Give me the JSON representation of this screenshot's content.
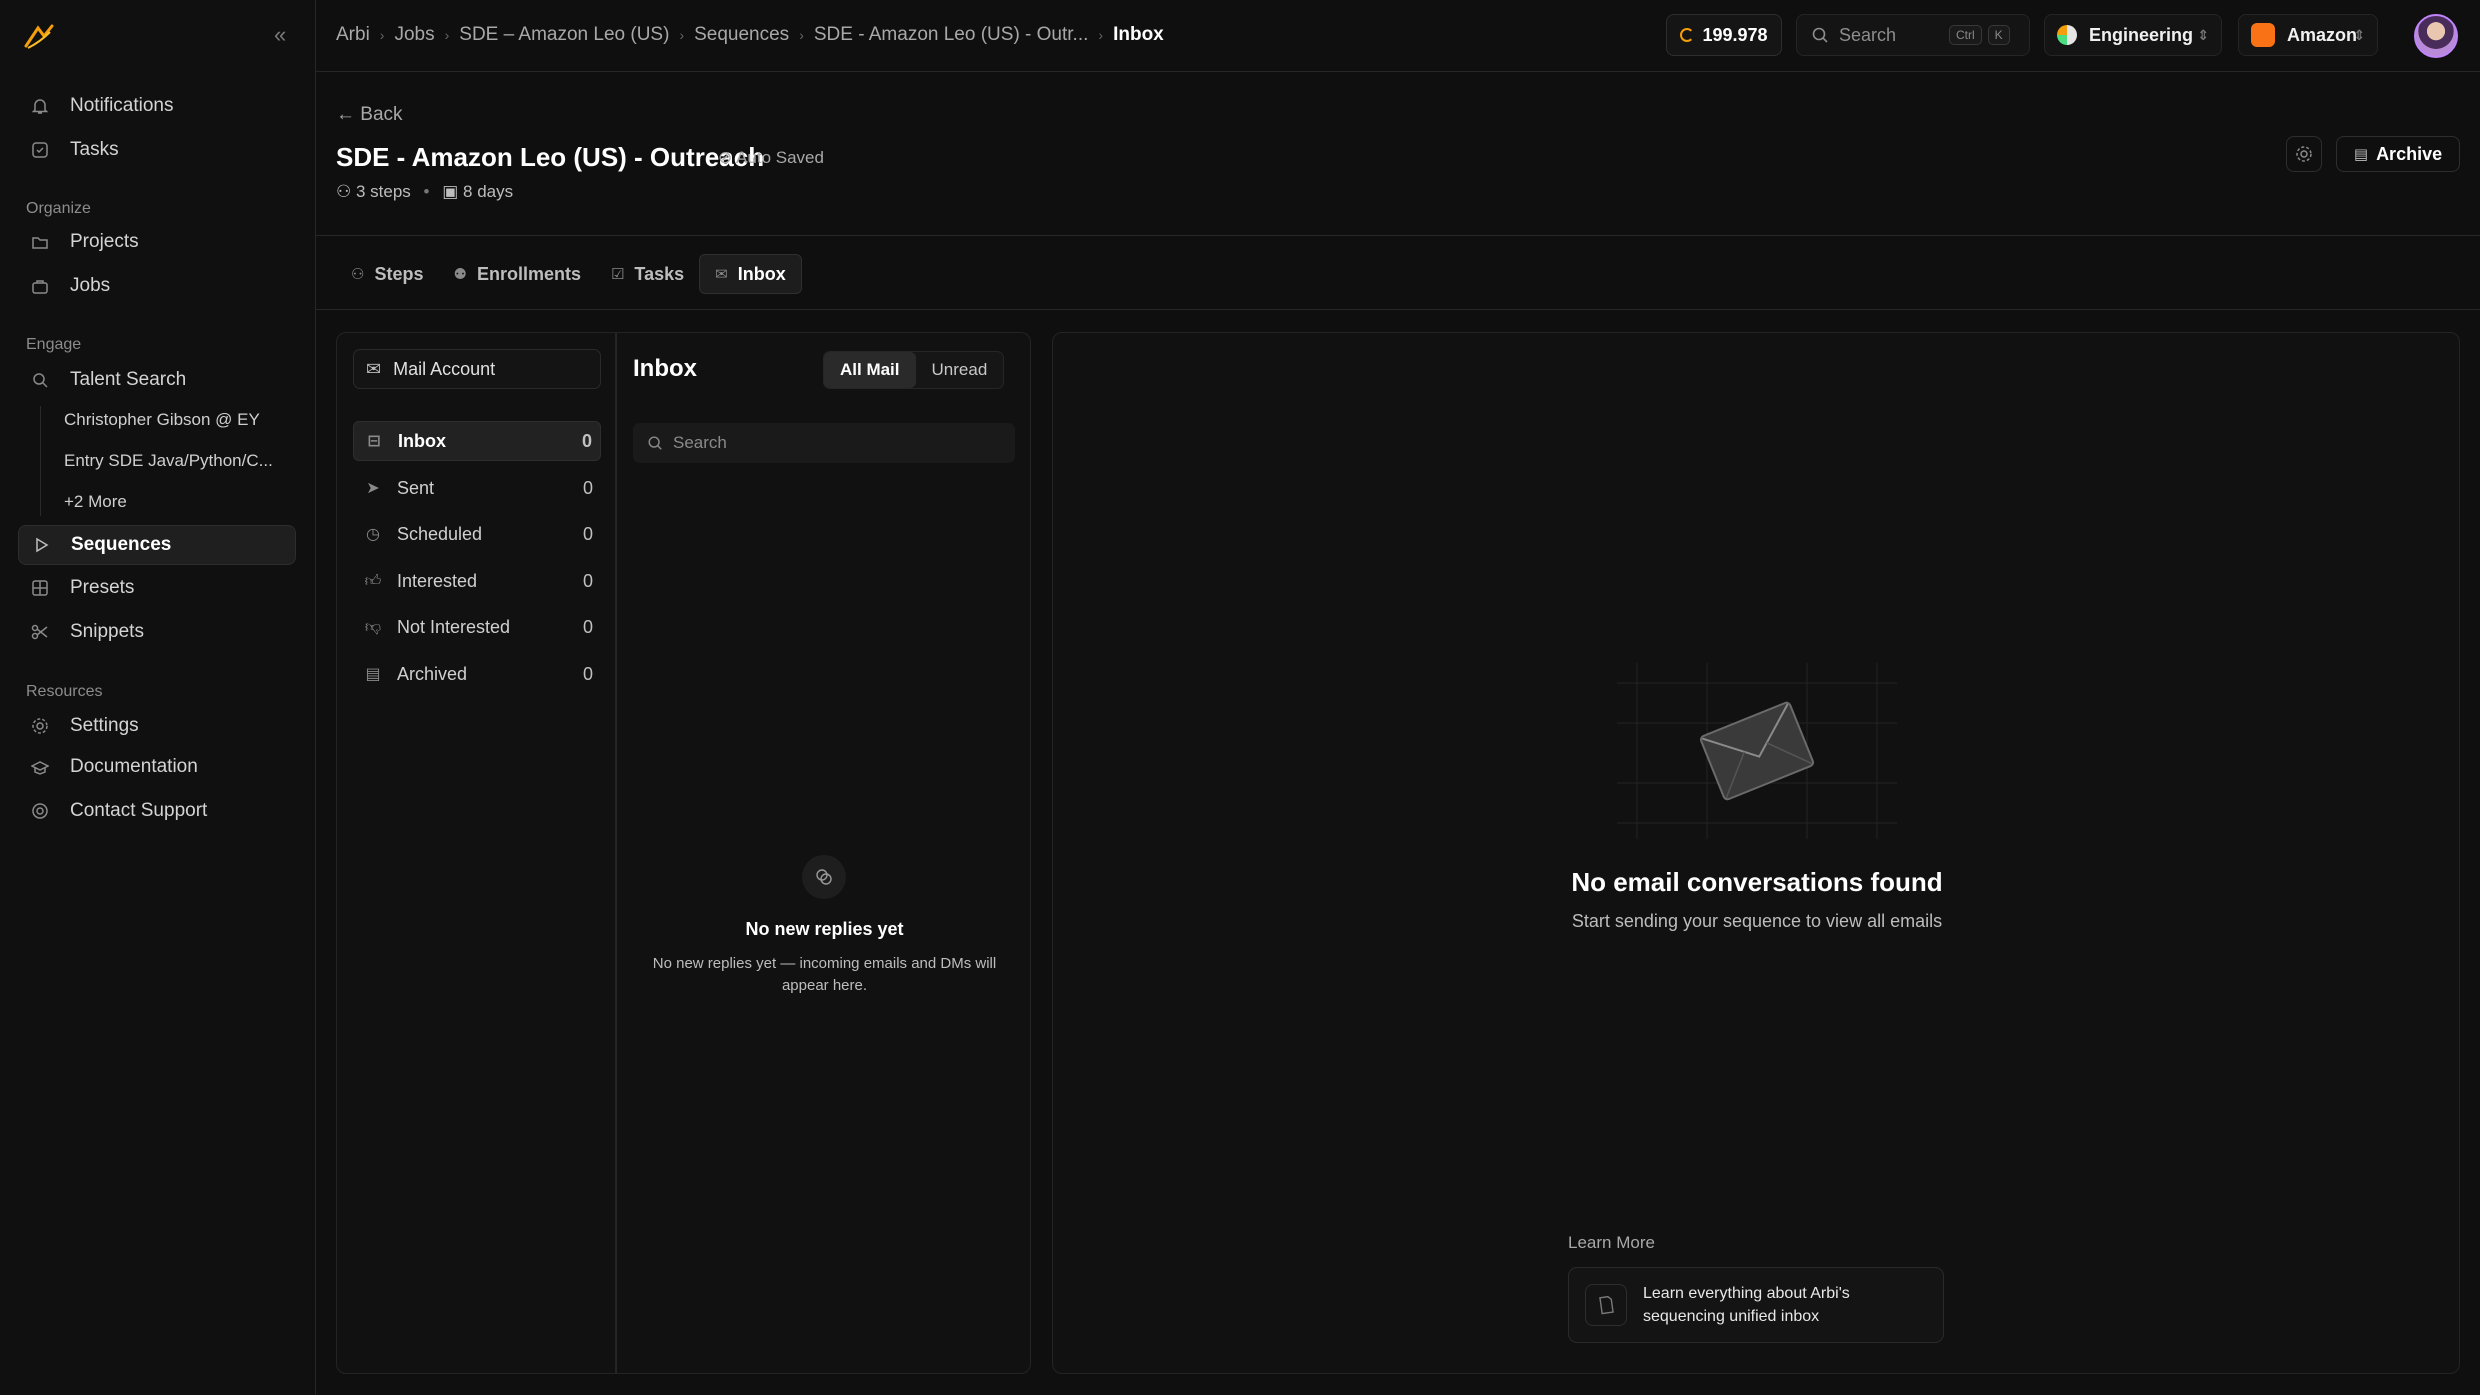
{
  "sidebar": {
    "top": [
      {
        "label": "Notifications",
        "icon": "bell-icon"
      },
      {
        "label": "Tasks",
        "icon": "tasks-icon"
      }
    ],
    "organize_label": "Organize",
    "organize": [
      {
        "label": "Projects",
        "icon": "folder-icon"
      },
      {
        "label": "Jobs",
        "icon": "briefcase-icon"
      }
    ],
    "engage_label": "Engage",
    "talent_search": "Talent Search",
    "saved_searches": [
      "Christopher Gibson @ EY",
      "Entry SDE Java/Python/C...",
      "+2 More"
    ],
    "engage": [
      {
        "label": "Sequences",
        "icon": "play-icon",
        "active": true
      },
      {
        "label": "Presets",
        "icon": "grid-icon"
      },
      {
        "label": "Snippets",
        "icon": "scissors-icon"
      }
    ],
    "resources_label": "Resources",
    "resources": [
      {
        "label": "Settings",
        "icon": "gear-icon"
      },
      {
        "label": "Documentation",
        "icon": "book-icon"
      },
      {
        "label": "Contact Support",
        "icon": "support-icon"
      }
    ]
  },
  "breadcrumbs": [
    "Arbi",
    "Jobs",
    "SDE – Amazon Leo (US)",
    "Sequences",
    "SDE - Amazon Leo (US) - Outr...",
    "Inbox"
  ],
  "topbar": {
    "credits": "199.978",
    "search_label": "Search",
    "kbd_ctrl": "Ctrl",
    "kbd_k": "K",
    "team": "Engineering",
    "company": "Amazon"
  },
  "header": {
    "back": "Back",
    "title": "SDE - Amazon Leo (US) - Outreach",
    "autosaved": "Auto Saved",
    "steps": "3 steps",
    "days": "8 days",
    "archive": "Archive"
  },
  "tabs": [
    "Steps",
    "Enrollments",
    "Tasks",
    "Inbox"
  ],
  "active_tab": "Inbox",
  "folders": {
    "mail_account": "Mail Account",
    "items": [
      {
        "label": "Inbox",
        "count": "0"
      },
      {
        "label": "Sent",
        "count": "0"
      },
      {
        "label": "Scheduled",
        "count": "0"
      },
      {
        "label": "Interested",
        "count": "0"
      },
      {
        "label": "Not Interested",
        "count": "0"
      },
      {
        "label": "Archived",
        "count": "0"
      }
    ]
  },
  "list": {
    "title": "Inbox",
    "filter_all": "All Mail",
    "filter_unread": "Unread",
    "search_placeholder": "Search",
    "empty_title": "No new replies yet",
    "empty_sub": "No new replies yet — incoming emails and DMs will appear here."
  },
  "detail": {
    "empty_title": "No email conversations found",
    "empty_sub": "Start sending your sequence to view all emails",
    "learn_label": "Learn More",
    "learn_card": "Learn everything about Arbi's sequencing unified inbox"
  },
  "colors": {
    "accent": "#f59e0b",
    "brand_orange": "#f97316",
    "bg": "#0f0f0f"
  }
}
